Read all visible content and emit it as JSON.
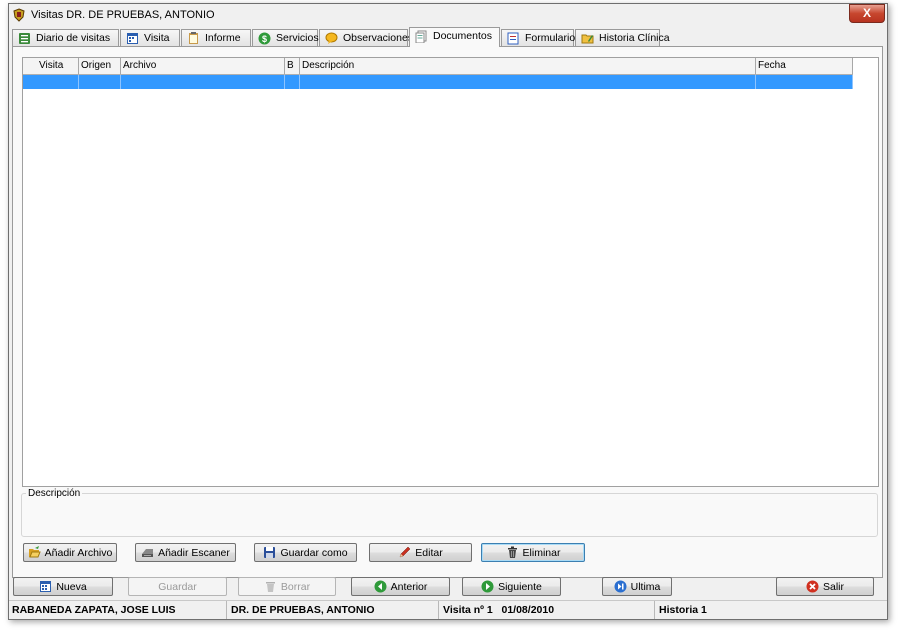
{
  "window": {
    "title": "Visitas DR. DE PRUEBAS, ANTONIO",
    "close_label": "X"
  },
  "tabs": [
    {
      "label": "Diario de visitas",
      "icon": "list-icon"
    },
    {
      "label": "Visita",
      "icon": "calendar-icon"
    },
    {
      "label": "Informe",
      "icon": "clipboard-icon"
    },
    {
      "label": "Servicios",
      "icon": "dollar-icon"
    },
    {
      "label": "Observaciones",
      "icon": "speech-bubble-icon"
    },
    {
      "label": "Documentos",
      "icon": "documents-icon",
      "active": true
    },
    {
      "label": "Formularios",
      "icon": "form-icon"
    },
    {
      "label": "Historia Clínica",
      "icon": "folder-edit-icon"
    }
  ],
  "table": {
    "columns": [
      "Visita",
      "Origen",
      "Archivo",
      "B",
      "Descripción",
      "Fecha"
    ],
    "rows": [
      [
        "",
        "",
        "",
        "",
        "",
        ""
      ]
    ],
    "selected_row": 0
  },
  "description": {
    "label": "Descripción",
    "value": ""
  },
  "doc_buttons": {
    "add_file": "Añadir Archivo",
    "add_scanner": "Añadir Escaner",
    "save_as": "Guardar como",
    "edit": "Editar",
    "delete": "Eliminar"
  },
  "nav_buttons": {
    "new": "Nueva",
    "save": "Guardar",
    "erase": "Borrar",
    "previous": "Anterior",
    "next": "Siguiente",
    "last": "Ultima",
    "exit": "Salir"
  },
  "status": {
    "patient": "RABANEDA ZAPATA, JOSE LUIS",
    "doctor": "DR. DE PRUEBAS, ANTONIO",
    "visit": "Visita nº 1   01/08/2010",
    "history": "Historia 1"
  },
  "colors": {
    "selection": "#3399ff",
    "accent": "#d0e8ff"
  }
}
